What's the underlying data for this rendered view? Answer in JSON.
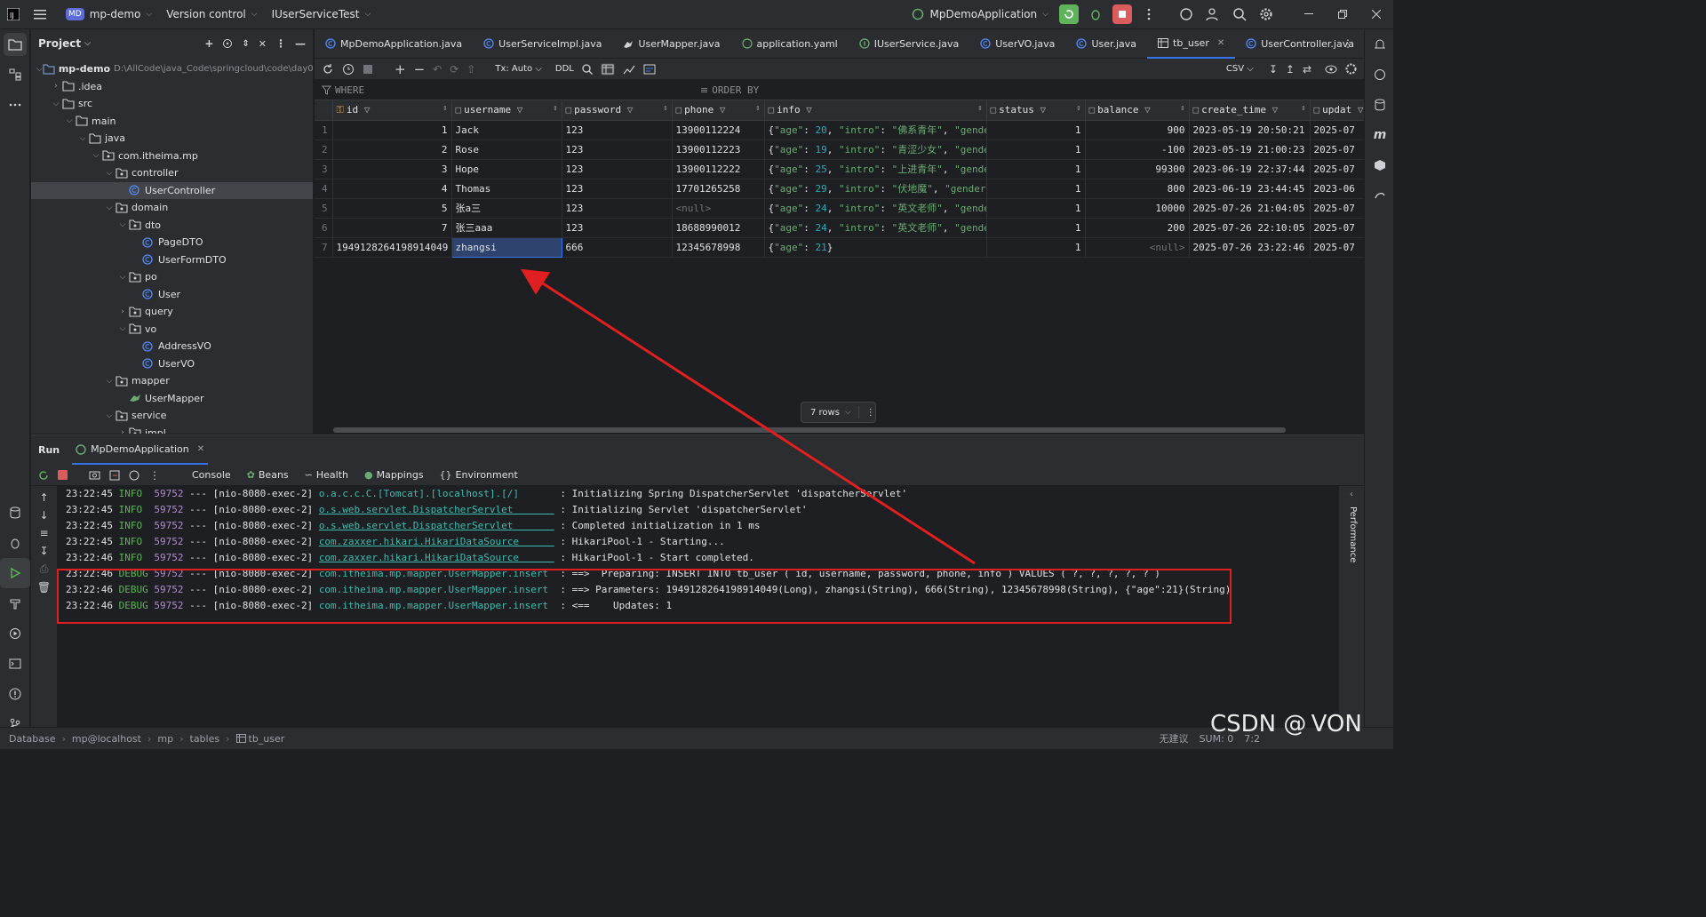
{
  "titlebar": {
    "project_badge": "MD",
    "project_name": "mp-demo",
    "vcs": "Version control",
    "run_config_file": "IUserServiceTest",
    "app_config": "MpDemoApplication"
  },
  "project_panel": {
    "title": "Project",
    "root_name": "mp-demo",
    "root_path": "D:\\AllCode\\java_Code\\springcloud\\code\\day01",
    "items": [
      {
        "label": ".idea",
        "type": "folder"
      },
      {
        "label": "src",
        "type": "folder"
      },
      {
        "label": "main",
        "type": "folder"
      },
      {
        "label": "java",
        "type": "folder"
      },
      {
        "label": "com.itheima.mp",
        "type": "package"
      },
      {
        "label": "controller",
        "type": "package"
      },
      {
        "label": "UserController",
        "type": "class"
      },
      {
        "label": "domain",
        "type": "package"
      },
      {
        "label": "dto",
        "type": "package"
      },
      {
        "label": "PageDTO",
        "type": "class"
      },
      {
        "label": "UserFormDTO",
        "type": "class"
      },
      {
        "label": "po",
        "type": "package"
      },
      {
        "label": "User",
        "type": "class"
      },
      {
        "label": "query",
        "type": "package"
      },
      {
        "label": "vo",
        "type": "package"
      },
      {
        "label": "AddressVO",
        "type": "class"
      },
      {
        "label": "UserVO",
        "type": "class"
      },
      {
        "label": "mapper",
        "type": "package"
      },
      {
        "label": "UserMapper",
        "type": "mapper"
      },
      {
        "label": "service",
        "type": "package"
      },
      {
        "label": "impl",
        "type": "package"
      }
    ]
  },
  "editor_tabs": [
    {
      "label": "MpDemoApplication.java"
    },
    {
      "label": "UserServiceImpl.java"
    },
    {
      "label": "UserMapper.java"
    },
    {
      "label": "application.yaml"
    },
    {
      "label": "IUserService.java"
    },
    {
      "label": "UserVO.java"
    },
    {
      "label": "User.java"
    },
    {
      "label": "tb_user"
    },
    {
      "label": "UserController.java"
    }
  ],
  "db_toolbar": {
    "tx": "Tx: Auto",
    "ddl": "DDL",
    "export": "CSV"
  },
  "filter": {
    "where": "WHERE",
    "order_by": "ORDER BY"
  },
  "table": {
    "columns": [
      "id",
      "username",
      "password",
      "phone",
      "info",
      "status",
      "balance",
      "create_time",
      "updat"
    ],
    "rows": [
      {
        "n": "1",
        "id": "1",
        "username": "Jack",
        "password": "123",
        "phone": "13900112224",
        "info_age": "20",
        "info_intro": "佛系青年",
        "status": "1",
        "balance": "900",
        "create_time": "2023-05-19 20:50:21",
        "update": "2025-07"
      },
      {
        "n": "2",
        "id": "2",
        "username": "Rose",
        "password": "123",
        "phone": "13900112223",
        "info_age": "19",
        "info_intro": "青涩少女",
        "status": "1",
        "balance": "-100",
        "create_time": "2023-05-19 21:00:23",
        "update": "2025-07"
      },
      {
        "n": "3",
        "id": "3",
        "username": "Hope",
        "password": "123",
        "phone": "13900112222",
        "info_age": "25",
        "info_intro": "上进青年",
        "status": "1",
        "balance": "99300",
        "create_time": "2023-06-19 22:37:44",
        "update": "2025-07"
      },
      {
        "n": "4",
        "id": "4",
        "username": "Thomas",
        "password": "123",
        "phone": "17701265258",
        "info_age": "29",
        "info_intro": "伏地魔",
        "status": "1",
        "balance": "800",
        "create_time": "2023-06-19 23:44:45",
        "update": "2023-06"
      },
      {
        "n": "5",
        "id": "5",
        "username": "张a三",
        "password": "123",
        "phone": "<null>",
        "info_age": "24",
        "info_intro": "英文老师",
        "status": "1",
        "balance": "10000",
        "create_time": "2025-07-26 21:04:05",
        "update": "2025-07"
      },
      {
        "n": "6",
        "id": "7",
        "username": "张三aaa",
        "password": "123",
        "phone": "18688990012",
        "info_age": "24",
        "info_intro": "英文老师",
        "status": "1",
        "balance": "200",
        "create_time": "2025-07-26 22:10:05",
        "update": "2025-07"
      },
      {
        "n": "7",
        "id": "1949128264198914049",
        "username": "zhangsi",
        "password": "666",
        "phone": "12345678998",
        "info_age": "21",
        "info_intro": "",
        "status": "1",
        "balance": "<null>",
        "create_time": "2025-07-26 23:22:46",
        "update": "2025-07"
      }
    ],
    "rows_badge": "7 rows"
  },
  "run_panel": {
    "title": "Run",
    "config_tab": "MpDemoApplication",
    "tabs": [
      "Console",
      "Beans",
      "Health",
      "Mappings",
      "Environment"
    ],
    "logs": [
      {
        "time": "23:22:45",
        "level": "INFO ",
        "pid": "59752",
        "thread": "--- [nio-8080-exec-2]",
        "logger": "o.a.c.c.C.[Tomcat].[localhost].[/]      ",
        "msg": ": Initializing Spring DispatcherServlet 'dispatcherServlet'"
      },
      {
        "time": "23:22:45",
        "level": "INFO ",
        "pid": "59752",
        "thread": "--- [nio-8080-exec-2]",
        "logger": "o.s.web.servlet.DispatcherServlet       ",
        "msg": ": Initializing Servlet 'dispatcherServlet'"
      },
      {
        "time": "23:22:45",
        "level": "INFO ",
        "pid": "59752",
        "thread": "--- [nio-8080-exec-2]",
        "logger": "o.s.web.servlet.DispatcherServlet       ",
        "msg": ": Completed initialization in 1 ms"
      },
      {
        "time": "23:22:45",
        "level": "INFO ",
        "pid": "59752",
        "thread": "--- [nio-8080-exec-2]",
        "logger": "com.zaxxer.hikari.HikariDataSource      ",
        "msg": ": HikariPool-1 - Starting..."
      },
      {
        "time": "23:22:46",
        "level": "INFO ",
        "pid": "59752",
        "thread": "--- [nio-8080-exec-2]",
        "logger": "com.zaxxer.hikari.HikariDataSource      ",
        "msg": ": HikariPool-1 - Start completed."
      },
      {
        "time": "23:22:46",
        "level": "DEBUG",
        "pid": "59752",
        "thread": "--- [nio-8080-exec-2]",
        "logger": "com.itheima.mp.mapper.UserMapper.insert ",
        "msg": ": ==>  Preparing: INSERT INTO tb_user ( id, username, password, phone, info ) VALUES ( ?, ?, ?, ?, ? )"
      },
      {
        "time": "23:22:46",
        "level": "DEBUG",
        "pid": "59752",
        "thread": "--- [nio-8080-exec-2]",
        "logger": "com.itheima.mp.mapper.UserMapper.insert ",
        "msg": ": ==> Parameters: 1949128264198914049(Long), zhangsi(String), 666(String), 12345678998(String), {\"age\":21}(String)"
      },
      {
        "time": "23:22:46",
        "level": "DEBUG",
        "pid": "59752",
        "thread": "--- [nio-8080-exec-2]",
        "logger": "com.itheima.mp.mapper.UserMapper.insert ",
        "msg": ": <==    Updates: 1"
      }
    ],
    "perf_label": "Performance"
  },
  "statusbar": {
    "crumbs": [
      "Database",
      "mp@localhost",
      "mp",
      "tables",
      "tb_user"
    ],
    "right_status": "无建议",
    "sum": "SUM: 0",
    "pos": "7:2"
  },
  "watermark": "CSDN @ VON",
  "colors": {
    "accent": "#3574f0",
    "annotation": "#e02020",
    "string": "#6aab73",
    "number": "#2aacb8"
  }
}
